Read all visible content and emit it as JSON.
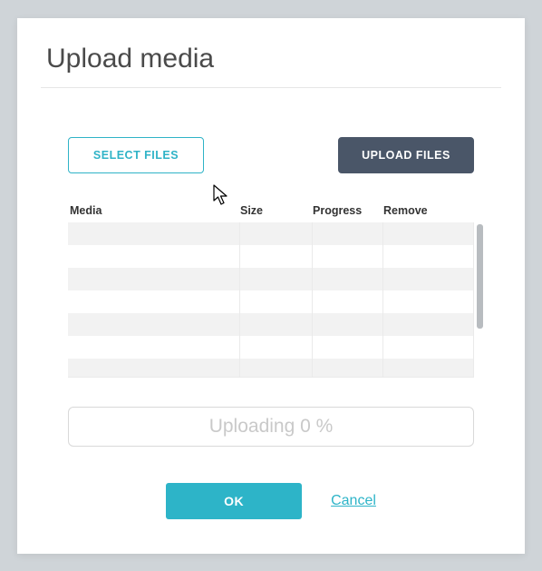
{
  "dialog": {
    "title": "Upload media",
    "buttons": {
      "select_files": "SELECT FILES",
      "upload_files": "UPLOAD FILES"
    },
    "table": {
      "headers": {
        "media": "Media",
        "size": "Size",
        "progress": "Progress",
        "remove": "Remove"
      }
    },
    "progress_text": "Uploading 0 %",
    "footer": {
      "ok": "OK",
      "cancel": "Cancel"
    }
  },
  "colors": {
    "accent": "#2db4c8",
    "dark_button": "#4a5668",
    "page_bg": "#cfd4d8"
  }
}
